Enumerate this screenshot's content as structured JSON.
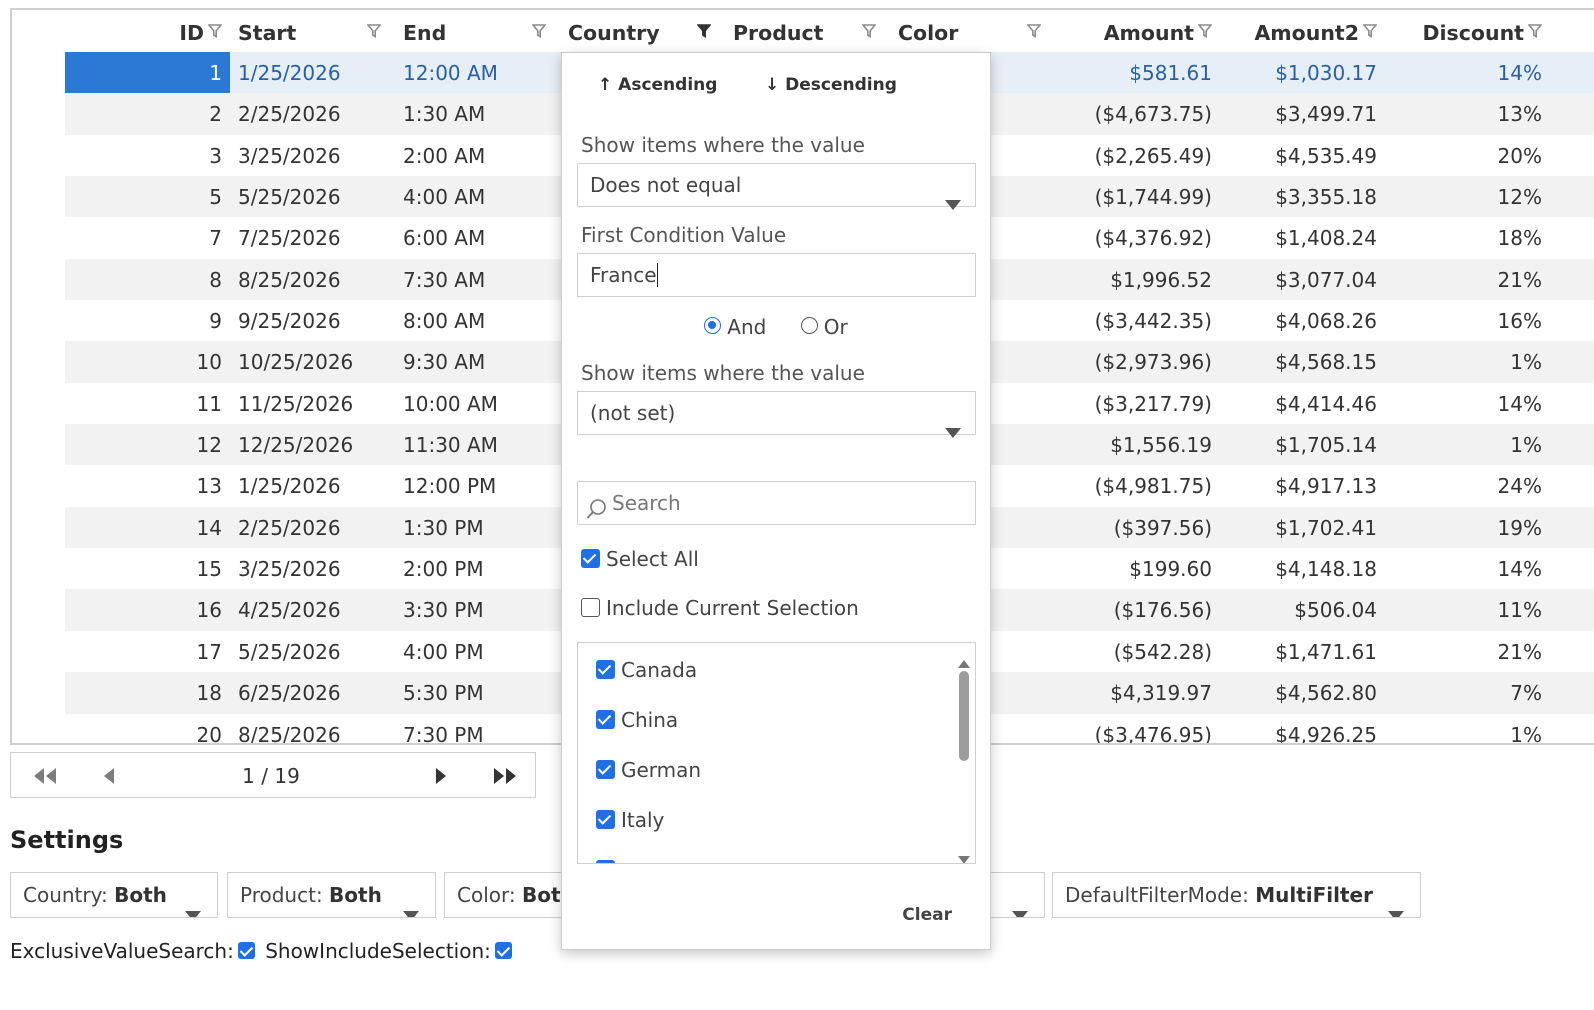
{
  "grid": {
    "headers": {
      "id": "ID",
      "start": "Start",
      "end": "End",
      "country": "Country",
      "product": "Product",
      "color": "Color",
      "amount": "Amount",
      "amount2": "Amount2",
      "discount": "Discount"
    },
    "rows": [
      {
        "id": "1",
        "start": "1/25/2026",
        "end": "12:00 AM",
        "amount": "$581.61",
        "amount2": "$1,030.17",
        "discount": "14%"
      },
      {
        "id": "2",
        "start": "2/25/2026",
        "end": "1:30 AM",
        "amount": "($4,673.75)",
        "amount2": "$3,499.71",
        "discount": "13%"
      },
      {
        "id": "3",
        "start": "3/25/2026",
        "end": "2:00 AM",
        "amount": "($2,265.49)",
        "amount2": "$4,535.49",
        "discount": "20%"
      },
      {
        "id": "5",
        "start": "5/25/2026",
        "end": "4:00 AM",
        "amount": "($1,744.99)",
        "amount2": "$3,355.18",
        "discount": "12%"
      },
      {
        "id": "7",
        "start": "7/25/2026",
        "end": "6:00 AM",
        "amount": "($4,376.92)",
        "amount2": "$1,408.24",
        "discount": "18%"
      },
      {
        "id": "8",
        "start": "8/25/2026",
        "end": "7:30 AM",
        "amount": "$1,996.52",
        "amount2": "$3,077.04",
        "discount": "21%"
      },
      {
        "id": "9",
        "start": "9/25/2026",
        "end": "8:00 AM",
        "amount": "($3,442.35)",
        "amount2": "$4,068.26",
        "discount": "16%"
      },
      {
        "id": "10",
        "start": "10/25/2026",
        "end": "9:30 AM",
        "amount": "($2,973.96)",
        "amount2": "$4,568.15",
        "discount": "1%"
      },
      {
        "id": "11",
        "start": "11/25/2026",
        "end": "10:00 AM",
        "amount": "($3,217.79)",
        "amount2": "$4,414.46",
        "discount": "14%"
      },
      {
        "id": "12",
        "start": "12/25/2026",
        "end": "11:30 AM",
        "amount": "$1,556.19",
        "amount2": "$1,705.14",
        "discount": "1%"
      },
      {
        "id": "13",
        "start": "1/25/2026",
        "end": "12:00 PM",
        "amount": "($4,981.75)",
        "amount2": "$4,917.13",
        "discount": "24%"
      },
      {
        "id": "14",
        "start": "2/25/2026",
        "end": "1:30 PM",
        "amount": "($397.56)",
        "amount2": "$1,702.41",
        "discount": "19%"
      },
      {
        "id": "15",
        "start": "3/25/2026",
        "end": "2:00 PM",
        "amount": "$199.60",
        "amount2": "$4,148.18",
        "discount": "14%"
      },
      {
        "id": "16",
        "start": "4/25/2026",
        "end": "3:30 PM",
        "amount": "($176.56)",
        "amount2": "$506.04",
        "discount": "11%"
      },
      {
        "id": "17",
        "start": "5/25/2026",
        "end": "4:00 PM",
        "amount": "($542.28)",
        "amount2": "$1,471.61",
        "discount": "21%"
      },
      {
        "id": "18",
        "start": "6/25/2026",
        "end": "5:30 PM",
        "amount": "$4,319.97",
        "amount2": "$4,562.80",
        "discount": "7%"
      },
      {
        "id": "20",
        "start": "8/25/2026",
        "end": "7:30 PM",
        "amount": "($3,476.95)",
        "amount2": "$4,926.25",
        "discount": "1%"
      }
    ]
  },
  "pager": {
    "text": "1 / 19"
  },
  "settings": {
    "title": "Settings",
    "country": {
      "label": "Country:",
      "value": "Both"
    },
    "product": {
      "label": "Product:",
      "value": "Both"
    },
    "color": {
      "label": "Color:",
      "value": "Both"
    },
    "default_filter_mode": {
      "label": "DefaultFilterMode:",
      "value": "MultiFilter"
    },
    "exclusive_value_search": "ExclusiveValueSearch:",
    "show_include_selection": "ShowIncludeSelection:"
  },
  "filter": {
    "ascending": "↑ Ascending",
    "descending": "↓ Descending",
    "show_items_label_1": "Show items where the value",
    "condition1": "Does not equal",
    "first_value_label": "First Condition Value",
    "first_value": "France",
    "and": "And",
    "or": "Or",
    "show_items_label_2": "Show items where the value",
    "condition2": "(not set)",
    "search_placeholder": "Search",
    "select_all": "Select All",
    "include_current_selection": "Include Current Selection",
    "items": [
      "Canada",
      "China",
      "German",
      "Italy"
    ],
    "clear": "Clear"
  },
  "colors": {
    "accent": "#1f6fe5",
    "selected_row": "#e6eef7",
    "selected_id": "#2b79d4",
    "link_text": "#2a5fa5"
  }
}
